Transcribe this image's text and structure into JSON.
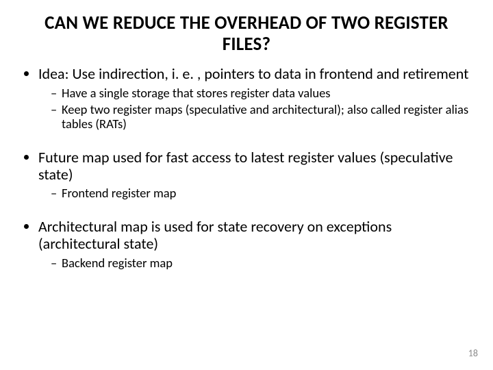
{
  "title": "CAN WE REDUCE THE OVERHEAD OF TWO REGISTER FILES?",
  "bullets": {
    "b1": {
      "text": "Idea: Use indirection, i. e. , pointers to data in frontend and retirement",
      "sub1": "Have a single storage that stores register data values",
      "sub2": "Keep two register maps (speculative and architectural); also called register alias tables (RATs)"
    },
    "b2": {
      "text": "Future map used for fast access to latest register values (speculative state)",
      "sub1": "Frontend register map"
    },
    "b3": {
      "text": "Architectural map is used for state recovery on exceptions (architectural state)",
      "sub1": "Backend register map"
    }
  },
  "page_number": "18"
}
